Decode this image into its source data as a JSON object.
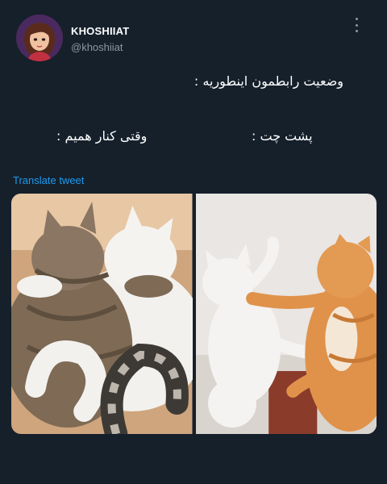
{
  "tweet": {
    "author": {
      "display_name": "KHOSHIIAT",
      "handle": "@khoshiiat",
      "avatar_icon": "avatar-illustration-icon"
    },
    "more_icon": "vertical-ellipsis-icon",
    "text_lines": [
      "وضعیت رابطمون اینطوریه :",
      "پشت چت :",
      "وقتی کنار همیم :"
    ],
    "translate_label": "Translate tweet",
    "media": [
      {
        "alt": "",
        "content": "two cats hugging"
      },
      {
        "alt": "",
        "content": "two cats fighting"
      }
    ]
  },
  "colors": {
    "background": "#15202b",
    "text_primary": "#ffffff",
    "text_secondary": "#8b98a5",
    "accent_link": "#1d9bf0"
  }
}
